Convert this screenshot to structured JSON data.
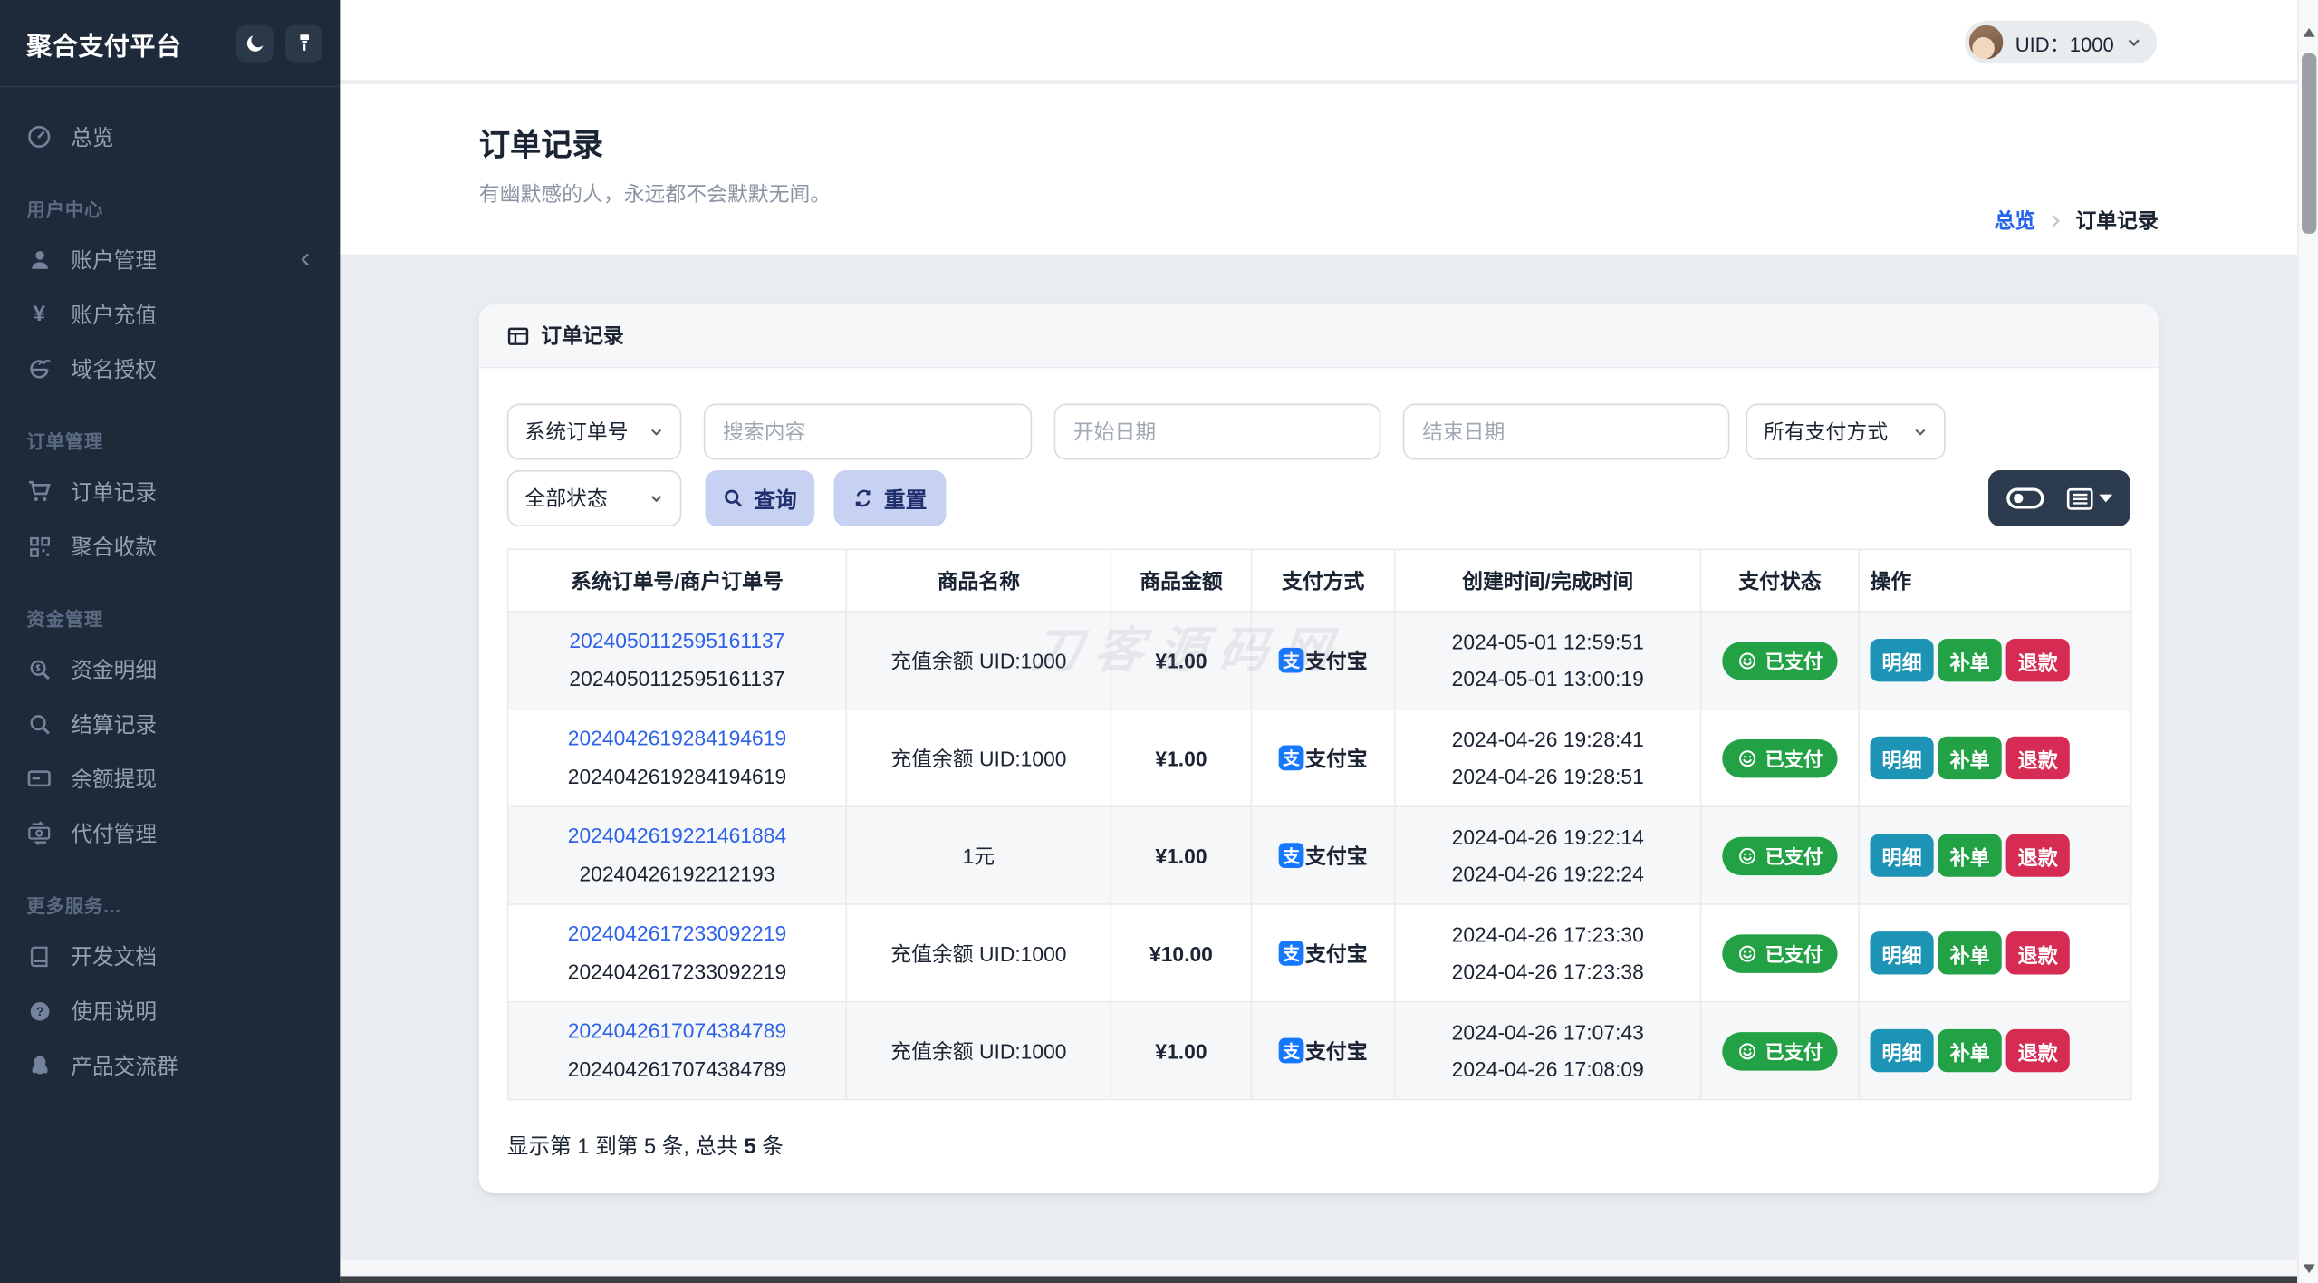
{
  "colors": {
    "sidebar_bg": "#1e2a3a",
    "accent_blue": "#2e63e8",
    "success_green": "#22a245",
    "info_teal": "#1d93b5",
    "danger_red": "#d62b52",
    "alipay_blue": "#1677ff",
    "button_soft_bg": "#c7d2f2",
    "button_soft_text": "#20306e",
    "toolbar_dark": "#2d3b4e"
  },
  "sidebar": {
    "brand": "聚合支付平台",
    "overview_label": "总览",
    "sections": [
      {
        "title": "用户中心",
        "items": [
          {
            "label": "账户管理",
            "icon": "user-icon"
          },
          {
            "label": "账户充值",
            "icon": "yen-icon",
            "icon_glyph": "¥"
          },
          {
            "label": "域名授权",
            "icon": "explorer-icon"
          }
        ]
      },
      {
        "title": "订单管理",
        "items": [
          {
            "label": "订单记录",
            "icon": "cart-icon"
          },
          {
            "label": "聚合收款",
            "icon": "qrcode-icon"
          }
        ]
      },
      {
        "title": "资金管理",
        "items": [
          {
            "label": "资金明细",
            "icon": "search-dollar-icon"
          },
          {
            "label": "结算记录",
            "icon": "search-icon"
          },
          {
            "label": "余额提现",
            "icon": "card-icon"
          },
          {
            "label": "代付管理",
            "icon": "transfer-icon"
          }
        ]
      },
      {
        "title": "更多服务...",
        "items": [
          {
            "label": "开发文档",
            "icon": "book-icon"
          },
          {
            "label": "使用说明",
            "icon": "question-icon"
          },
          {
            "label": "产品交流群",
            "icon": "qq-icon"
          }
        ]
      }
    ]
  },
  "header": {
    "uid_label": "UID：1000"
  },
  "page": {
    "title": "订单记录",
    "subtitle": "有幽默感的人，永远都不会默默无闻。",
    "breadcrumb": {
      "root": "总览",
      "current": "订单记录"
    }
  },
  "card": {
    "title": "订单记录"
  },
  "filters": {
    "order_type": "系统订单号",
    "search_placeholder": "搜索内容",
    "start_date_placeholder": "开始日期",
    "end_date_placeholder": "结束日期",
    "pay_method": "所有支付方式",
    "status": "全部状态",
    "query_label": "查询",
    "reset_label": "重置"
  },
  "table": {
    "columns": [
      "系统订单号/商户订单号",
      "商品名称",
      "商品金额",
      "支付方式",
      "创建时间/完成时间",
      "支付状态",
      "操作"
    ],
    "alipay_glyph": "支",
    "actions": {
      "detail": "明细",
      "reissue": "补单",
      "refund": "退款"
    },
    "rows": [
      {
        "order_no": "2024050112595161137",
        "merchant_no": "2024050112595161137",
        "product": "充值余额 UID:1000",
        "amount": "¥1.00",
        "method": "支付宝",
        "created": "2024-05-01 12:59:51",
        "completed": "2024-05-01 13:00:19",
        "status": "已支付"
      },
      {
        "order_no": "2024042619284194619",
        "merchant_no": "2024042619284194619",
        "product": "充值余额 UID:1000",
        "amount": "¥1.00",
        "method": "支付宝",
        "created": "2024-04-26 19:28:41",
        "completed": "2024-04-26 19:28:51",
        "status": "已支付"
      },
      {
        "order_no": "2024042619221461884",
        "merchant_no": "20240426192212193",
        "product": "1元",
        "amount": "¥1.00",
        "method": "支付宝",
        "created": "2024-04-26 19:22:14",
        "completed": "2024-04-26 19:22:24",
        "status": "已支付"
      },
      {
        "order_no": "2024042617233092219",
        "merchant_no": "2024042617233092219",
        "product": "充值余额 UID:1000",
        "amount": "¥10.00",
        "method": "支付宝",
        "created": "2024-04-26 17:23:30",
        "completed": "2024-04-26 17:23:38",
        "status": "已支付"
      },
      {
        "order_no": "2024042617074384789",
        "merchant_no": "2024042617074384789",
        "product": "充值余额 UID:1000",
        "amount": "¥1.00",
        "method": "支付宝",
        "created": "2024-04-26 17:07:43",
        "completed": "2024-04-26 17:08:09",
        "status": "已支付"
      }
    ]
  },
  "pagination": {
    "prefix": "显示第 1 到第 5 条, 总共 ",
    "total": "5",
    "suffix": " 条"
  },
  "watermark": "刀客源码网"
}
